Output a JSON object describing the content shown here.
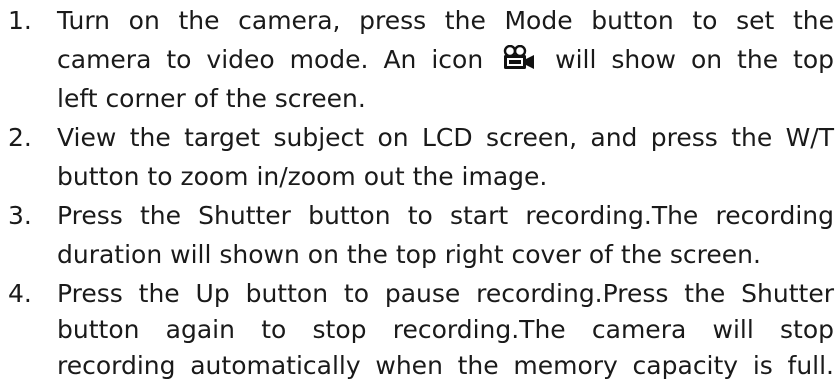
{
  "steps": [
    {
      "number": "1.",
      "lines": [
        "Turn on the camera, press the Mode button to set the",
        {
          "before": "camera to video mode. An icon",
          "icon": "video-camera-icon",
          "after": "will show on the top"
        },
        "left corner of the screen."
      ]
    },
    {
      "number": "2.",
      "lines": [
        "View the target subject on LCD screen, and press the W/T",
        "button to zoom in/zoom out the image."
      ]
    },
    {
      "number": "3.",
      "lines": [
        "Press the Shutter button to start recording.The recording",
        "duration will shown on the top right cover of the screen."
      ]
    },
    {
      "number": "4.",
      "lines": [
        "Press the Up button to pause recording.Press the Shutter",
        "button again to stop recording.The camera will stop",
        "recording automatically when the memory capacity is full."
      ]
    }
  ]
}
